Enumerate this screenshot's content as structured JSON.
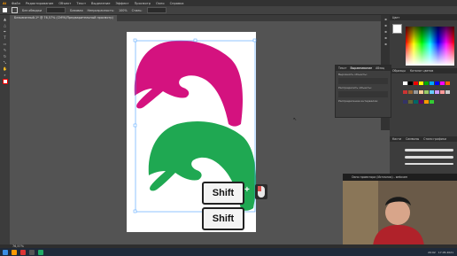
{
  "menubar": {
    "items": [
      "Ai",
      "Файл",
      "Редактирование",
      "Объект",
      "Текст",
      "Выделение",
      "Эффект",
      "Просмотр",
      "Окно",
      "Справка"
    ]
  },
  "controlbar": {
    "selection_label": "Без обводки",
    "stroke_label": "Базовая",
    "opacity_label": "Непрозрачность:",
    "opacity_value": "100%",
    "style_label": "Стиль:"
  },
  "document": {
    "tab_title": "Безымянный-1* @ 76,57% (CMYK/Предварительный просмотр)"
  },
  "statusbar": {
    "zoom": "76,57%",
    "tool_name": "Выделение",
    "page": "1"
  },
  "floating_panel": {
    "tabs": [
      "Текст",
      "Выравнивание",
      "Абзац"
    ],
    "rows": [
      "Выровнять объекты:",
      "Распределить объекты:",
      "Распределение интервалов:"
    ]
  },
  "right_panels": {
    "color_tab": "Цвет",
    "guide_tab": "Каталог цветов",
    "swatches_tab": "Образцы",
    "brushes_tab": "Кисти",
    "symbols_tab": "Символы",
    "graphic_styles_tab": "Стили графики"
  },
  "keystroke_overlay": {
    "key1": "Shift",
    "plus": "+",
    "key2": "Shift"
  },
  "webcam": {
    "title": "Окно проектора (Источник) - webcam"
  },
  "taskbar": {
    "time": "20:02",
    "date": "17.05.2021"
  },
  "colors": {
    "magenta_shape": "#d4127f",
    "green_shape": "#1fa852",
    "selection_box": "#4aa0ff"
  },
  "icons": [
    "selection-tool-icon",
    "direct-selection-icon",
    "pen-tool-icon",
    "type-tool-icon",
    "rectangle-tool-icon",
    "brush-icon",
    "rotate-icon",
    "scale-icon",
    "hand-icon",
    "zoom-icon",
    "mouse-icon",
    "cursor-icon"
  ]
}
